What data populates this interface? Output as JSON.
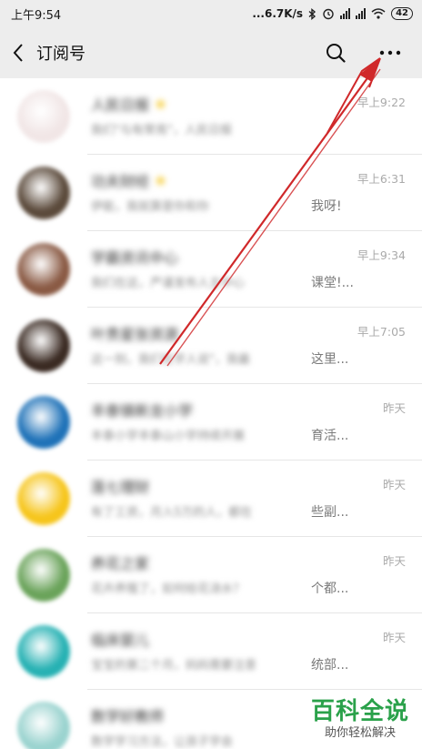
{
  "status_bar": {
    "time": "上午9:54",
    "network_speed": "...6.7K/s",
    "battery": "42"
  },
  "header": {
    "title": "订阅号",
    "back_icon": "chevron-left-icon",
    "search_icon": "search-icon",
    "more_icon": "more-dots-icon"
  },
  "list": [
    {
      "name": "人民日报",
      "starred": true,
      "preview": "我们\"与有荣焉\"，人民日报",
      "preview_tail": "",
      "time": "早上9:22",
      "avatar_color": "#f1e6e6"
    },
    {
      "name": "功夫财经",
      "starred": true,
      "preview": "伊能，我就算是你和你",
      "preview_tail": "我呀!",
      "time": "早上6:31",
      "avatar_color": "#5b4a3b"
    },
    {
      "name": "学霸资讯中心",
      "starred": false,
      "preview": "我们在这，严谨发布人主中心",
      "preview_tail": "课堂!...",
      "time": "早上9:34",
      "avatar_color": "#8a5a44"
    },
    {
      "name": "叶贵星张资源",
      "starred": false,
      "preview": "这一刻，我们在学人说\"，我最",
      "preview_tail": "这里...",
      "time": "早上7:05",
      "avatar_color": "#3a2a22"
    },
    {
      "name": "丰泰镇新龙小学",
      "starred": false,
      "preview": "丰泰小学丰泰山小学持续开展",
      "preview_tail": "育活...",
      "time": "昨天",
      "avatar_color": "#1f72b8"
    },
    {
      "name": "莲七理财",
      "starred": false,
      "preview": "有了工资，月入5万的人，都在",
      "preview_tail": "些副...",
      "time": "昨天",
      "avatar_color": "#f6c51b"
    },
    {
      "name": "养花之家",
      "starred": false,
      "preview": "花卉养殖了，如何给花浇水？",
      "preview_tail": "个都...",
      "time": "昨天",
      "avatar_color": "#6aa35a"
    },
    {
      "name": "临床婴儿",
      "starred": false,
      "preview": "宝宝的第二个月，妈妈需要注意",
      "preview_tail": "统部...",
      "time": "昨天",
      "avatar_color": "#26b1b3"
    },
    {
      "name": "数学好教师",
      "starred": false,
      "preview": "数学学习方法，让孩子学会",
      "preview_tail": "",
      "time": "",
      "avatar_color": "#9ad3cf"
    }
  ],
  "watermark": {
    "title": "百科全说",
    "subtitle": "助你轻松解决"
  },
  "colors": {
    "header_bg": "#ededed",
    "arrow": "#d0282a",
    "watermark": "#2aa14a"
  }
}
